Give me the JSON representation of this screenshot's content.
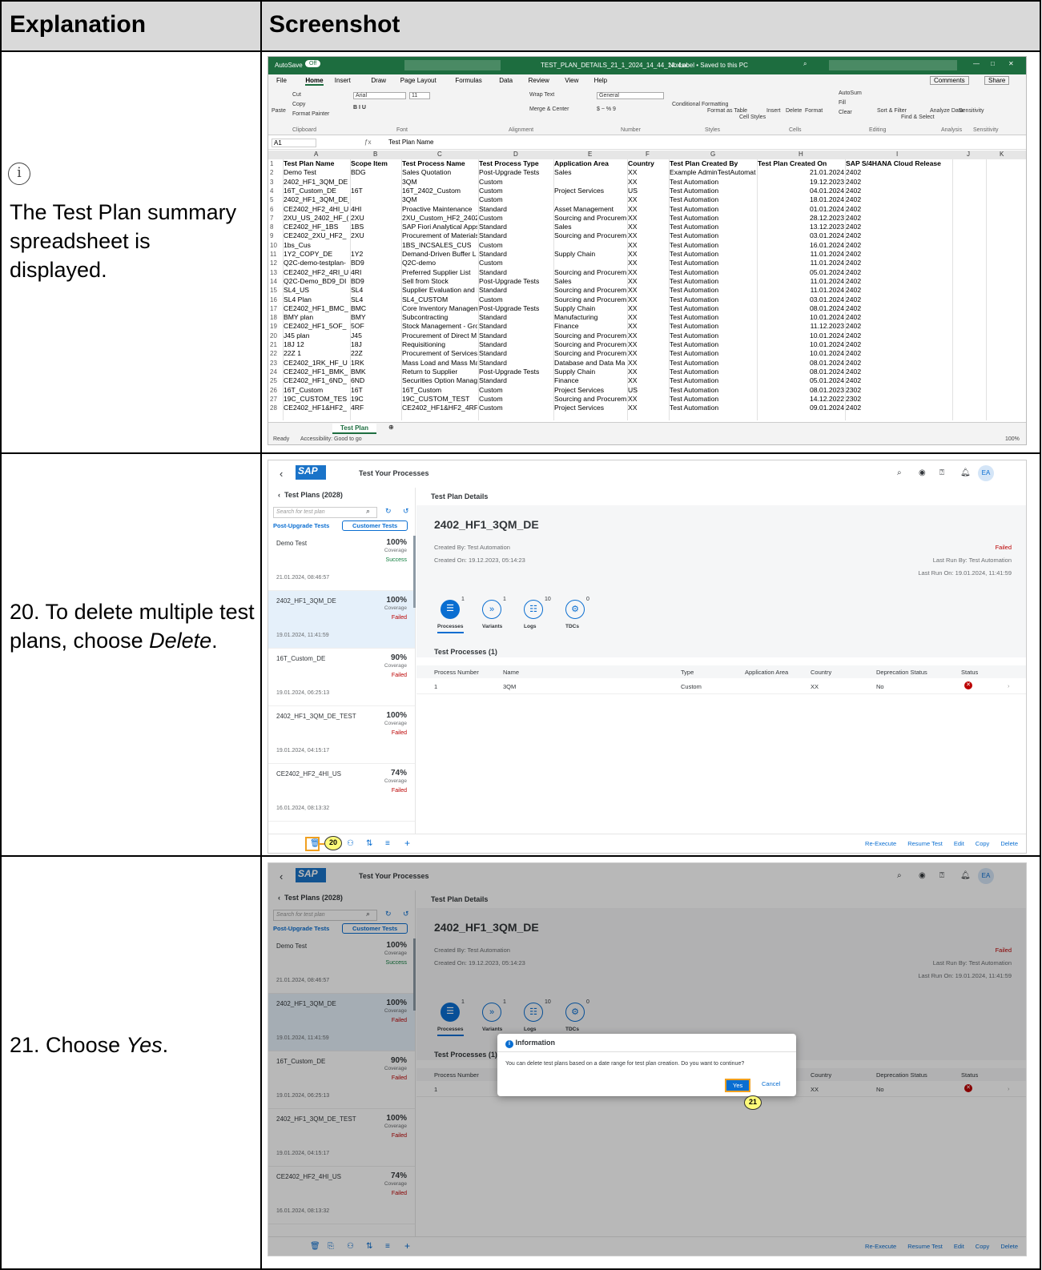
{
  "header": {
    "col1": "Explanation",
    "col2": "Screenshot"
  },
  "rows": [
    {
      "text": "The Test Plan summary spreadsheet is displayed."
    },
    {
      "text_a": "20. To delete multiple test plans, choose ",
      "text_em": "Delete",
      "text_b": "."
    },
    {
      "text_a": "21. Choose ",
      "text_em": "Yes",
      "text_b": "."
    }
  ],
  "excel": {
    "autosave": "AutoSave",
    "autosave_state": "Off",
    "file_title": "TEST_PLAN_DETAILS_21_1_2024_14_44_14.xlsx",
    "label_status": "No Label • Saved to this PC",
    "menu": [
      "File",
      "Home",
      "Insert",
      "Draw",
      "Page Layout",
      "Formulas",
      "Data",
      "Review",
      "View",
      "Help"
    ],
    "comments": "Comments",
    "share": "Share",
    "ribbon": {
      "cut": "Cut",
      "copy": "Copy",
      "paste": "Paste",
      "format_painter": "Format Painter",
      "font": "Arial",
      "font_size": "11",
      "wrap_text": "Wrap Text",
      "merge": "Merge & Center",
      "number_format": "General",
      "cond_format": "Conditional Formatting",
      "format_table": "Format as Table",
      "cell_styles": "Cell Styles",
      "insert": "Insert",
      "delete": "Delete",
      "format": "Format",
      "autosum": "AutoSum",
      "fill": "Fill",
      "clear": "Clear",
      "sort": "Sort & Filter",
      "find": "Find & Select",
      "analyze": "Analyze Data",
      "sensitivity": "Sensitivity",
      "groups": [
        "Clipboard",
        "Font",
        "Alignment",
        "Number",
        "Styles",
        "Cells",
        "Editing",
        "Analysis",
        "Sensitivity"
      ]
    },
    "cell_ref": "A1",
    "formula": "Test Plan Name",
    "columns": [
      "A",
      "B",
      "C",
      "D",
      "E",
      "F",
      "G",
      "H",
      "I",
      "J",
      "K"
    ],
    "headers": [
      "Test Plan Name",
      "Scope Item",
      "Test Process Name",
      "Test Process Type",
      "Application Area",
      "Country",
      "Test Plan Created By",
      "Test Plan Created On",
      "SAP S/4HANA Cloud Release"
    ],
    "rows": [
      [
        "Demo Test",
        "BDG",
        "Sales Quotation",
        "Post-Upgrade Tests",
        "Sales",
        "XX",
        "Example AdminTestAutomat",
        "21.01.2024",
        "2402"
      ],
      [
        "2402_HF1_3QM_DE",
        "",
        "3QM",
        "Custom",
        "",
        "XX",
        "Test Automation",
        "19.12.2023",
        "2402"
      ],
      [
        "16T_Custom_DE",
        "16T",
        "16T_2402_Custom",
        "Custom",
        "Project Services",
        "US",
        "Test Automation",
        "04.01.2024",
        "2402"
      ],
      [
        "2402_HF1_3QM_DE_TEST",
        "",
        "3QM",
        "Custom",
        "",
        "XX",
        "Test Automation",
        "18.01.2024",
        "2402"
      ],
      [
        "CE2402_HF2_4HI_U",
        "4HI",
        "Proactive Maintenance",
        "Standard",
        "Asset Management",
        "XX",
        "Test Automation",
        "01.01.2024",
        "2402"
      ],
      [
        "2XU_US_2402_HF_(",
        "2XU",
        "2XU_Custom_HF2_2402",
        "Custom",
        "Sourcing and Procurem",
        "XX",
        "Test Automation",
        "28.12.2023",
        "2402"
      ],
      [
        "CE2402_HF_1BS",
        "1BS",
        "SAP Fiori Analytical Apps",
        "Standard",
        "Sales",
        "XX",
        "Test Automation",
        "13.12.2023",
        "2402"
      ],
      [
        "CE2402_2XU_HF2_",
        "2XU",
        "Procurement of Materials",
        "Standard",
        "Sourcing and Procurem",
        "XX",
        "Test Automation",
        "03.01.2024",
        "2402"
      ],
      [
        "1bs_Cus",
        "",
        "1BS_INCSALES_CUS",
        "Custom",
        "",
        "XX",
        "Test Automation",
        "16.01.2024",
        "2402"
      ],
      [
        "1Y2_COPY_DE",
        "1Y2",
        "Demand-Driven Buffer L",
        "Standard",
        "Supply Chain",
        "XX",
        "Test Automation",
        "11.01.2024",
        "2402"
      ],
      [
        "Q2C-demo-testplan-",
        "BD9",
        "Q2C-demo",
        "Custom",
        "",
        "XX",
        "Test Automation",
        "11.01.2024",
        "2402"
      ],
      [
        "CE2402_HF2_4RI_U",
        "4RI",
        "Preferred Supplier List",
        "Standard",
        "Sourcing and Procurem",
        "XX",
        "Test Automation",
        "05.01.2024",
        "2402"
      ],
      [
        "Q2C-Demo_BD9_DI",
        "BD9",
        "Sell from Stock",
        "Post-Upgrade Tests",
        "Sales",
        "XX",
        "Test Automation",
        "11.01.2024",
        "2402"
      ],
      [
        "SL4_US",
        "SL4",
        "Supplier Evaluation and I",
        "Standard",
        "Sourcing and Procurem",
        "XX",
        "Test Automation",
        "11.01.2024",
        "2402"
      ],
      [
        "SL4 Plan",
        "SL4",
        "SL4_CUSTOM",
        "Custom",
        "Sourcing and Procurem",
        "XX",
        "Test Automation",
        "03.01.2024",
        "2402"
      ],
      [
        "CE2402_HF1_BMC_",
        "BMC",
        "Core Inventory Managem",
        "Post-Upgrade Tests",
        "Supply Chain",
        "XX",
        "Test Automation",
        "08.01.2024",
        "2402"
      ],
      [
        "BMY plan",
        "BMY",
        "Subcontracting",
        "Standard",
        "Manufacturing",
        "XX",
        "Test Automation",
        "10.01.2024",
        "2402"
      ],
      [
        "CE2402_HF1_5OF_",
        "5OF",
        "Stock Management - Gro",
        "Standard",
        "Finance",
        "XX",
        "Test Automation",
        "11.12.2023",
        "2402"
      ],
      [
        "J45 plan",
        "J45",
        "Procurement of Direct M",
        "Standard",
        "Sourcing and Procurem",
        "XX",
        "Test Automation",
        "10.01.2024",
        "2402"
      ],
      [
        "18J 12",
        "18J",
        "Requisitioning",
        "Standard",
        "Sourcing and Procurem",
        "XX",
        "Test Automation",
        "10.01.2024",
        "2402"
      ],
      [
        "22Z 1",
        "22Z",
        "Procurement of Services",
        "Standard",
        "Sourcing and Procurem",
        "XX",
        "Test Automation",
        "10.01.2024",
        "2402"
      ],
      [
        "CE2402_1RK_HF_U",
        "1RK",
        "Mass Load and Mass Ma",
        "Standard",
        "Database and Data Ma",
        "XX",
        "Test Automation",
        "08.01.2024",
        "2402"
      ],
      [
        "CE2402_HF1_BMK_",
        "BMK",
        "Return to Supplier",
        "Post-Upgrade Tests",
        "Supply Chain",
        "XX",
        "Test Automation",
        "08.01.2024",
        "2402"
      ],
      [
        "CE2402_HF1_6ND_",
        "6ND",
        "Securities Option Manag",
        "Standard",
        "Finance",
        "XX",
        "Test Automation",
        "05.01.2024",
        "2402"
      ],
      [
        "16T_Custom",
        "16T",
        "16T_Custom",
        "Custom",
        "Project Services",
        "US",
        "Test Automation",
        "08.01.2023",
        "2302"
      ],
      [
        "19C_CUSTOM_TES",
        "19C",
        "19C_CUSTOM_TEST",
        "Custom",
        "Sourcing and Procurem",
        "XX",
        "Test Automation",
        "14.12.2022",
        "2302"
      ],
      [
        "CE2402_HF1&HF2_",
        "4RF",
        "CE2402_HF1&HF2_4RF",
        "Custom",
        "Project Services",
        "XX",
        "Test Automation",
        "09.01.2024",
        "2402"
      ]
    ],
    "sheet_tab": "Test Plan",
    "status_ready": "Ready",
    "accessibility": "Accessibility: Good to go",
    "zoom": "100%"
  },
  "sap": {
    "app_title": "Test Your Processes",
    "avatar": "EA",
    "list_title": "Test Plans (2028)",
    "search_placeholder": "Search for test plan",
    "tab_post": "Post-Upgrade Tests",
    "tab_custom": "Customer Tests",
    "plans": [
      {
        "name": "Demo Test",
        "pct": "100%",
        "cov": "Coverage",
        "status": "Success",
        "date": "21.01.2024, 08:46:57"
      },
      {
        "name": "2402_HF1_3QM_DE",
        "pct": "100%",
        "cov": "Coverage",
        "status": "Failed",
        "date": "19.01.2024, 11:41:59"
      },
      {
        "name": "16T_Custom_DE",
        "pct": "90%",
        "cov": "Coverage",
        "status": "Failed",
        "date": "19.01.2024, 06:25:13"
      },
      {
        "name": "2402_HF1_3QM_DE_TEST",
        "pct": "100%",
        "cov": "Coverage",
        "status": "Failed",
        "date": "19.01.2024, 04:15:17"
      },
      {
        "name": "CE2402_HF2_4HI_US",
        "pct": "74%",
        "cov": "Coverage",
        "status": "Failed",
        "date": "16.01.2024, 08:13:32"
      }
    ],
    "details_title": "Test Plan Details",
    "plan_name": "2402_HF1_3QM_DE",
    "created_by": "Created By: Test Automation",
    "created_on": "Created On: 19.12.2023, 05:14:23",
    "status": "Failed",
    "last_run_by": "Last Run By: Test Automation",
    "last_run_on": "Last Run On: 19.01.2024, 11:41:59",
    "tabs": [
      {
        "label": "Processes",
        "count": "1"
      },
      {
        "label": "Variants",
        "count": "1"
      },
      {
        "label": "Logs",
        "count": "10"
      },
      {
        "label": "TDCs",
        "count": "0"
      }
    ],
    "processes_title": "Test Processes (1)",
    "table_headers": [
      "Process Number",
      "Name",
      "Type",
      "Application Area",
      "Country",
      "Deprecation Status",
      "Status"
    ],
    "table_row": [
      "1",
      "3QM",
      "Custom",
      "",
      "XX",
      "No"
    ],
    "footer_actions": [
      "Re-Execute",
      "Resume Test",
      "Edit",
      "Copy",
      "Delete"
    ],
    "callout_20": "20",
    "callout_21": "21",
    "dialog": {
      "title": "Information",
      "message": "You can delete test plans based on a date range for test plan creation. Do you want to continue?",
      "yes": "Yes",
      "cancel": "Cancel"
    }
  }
}
